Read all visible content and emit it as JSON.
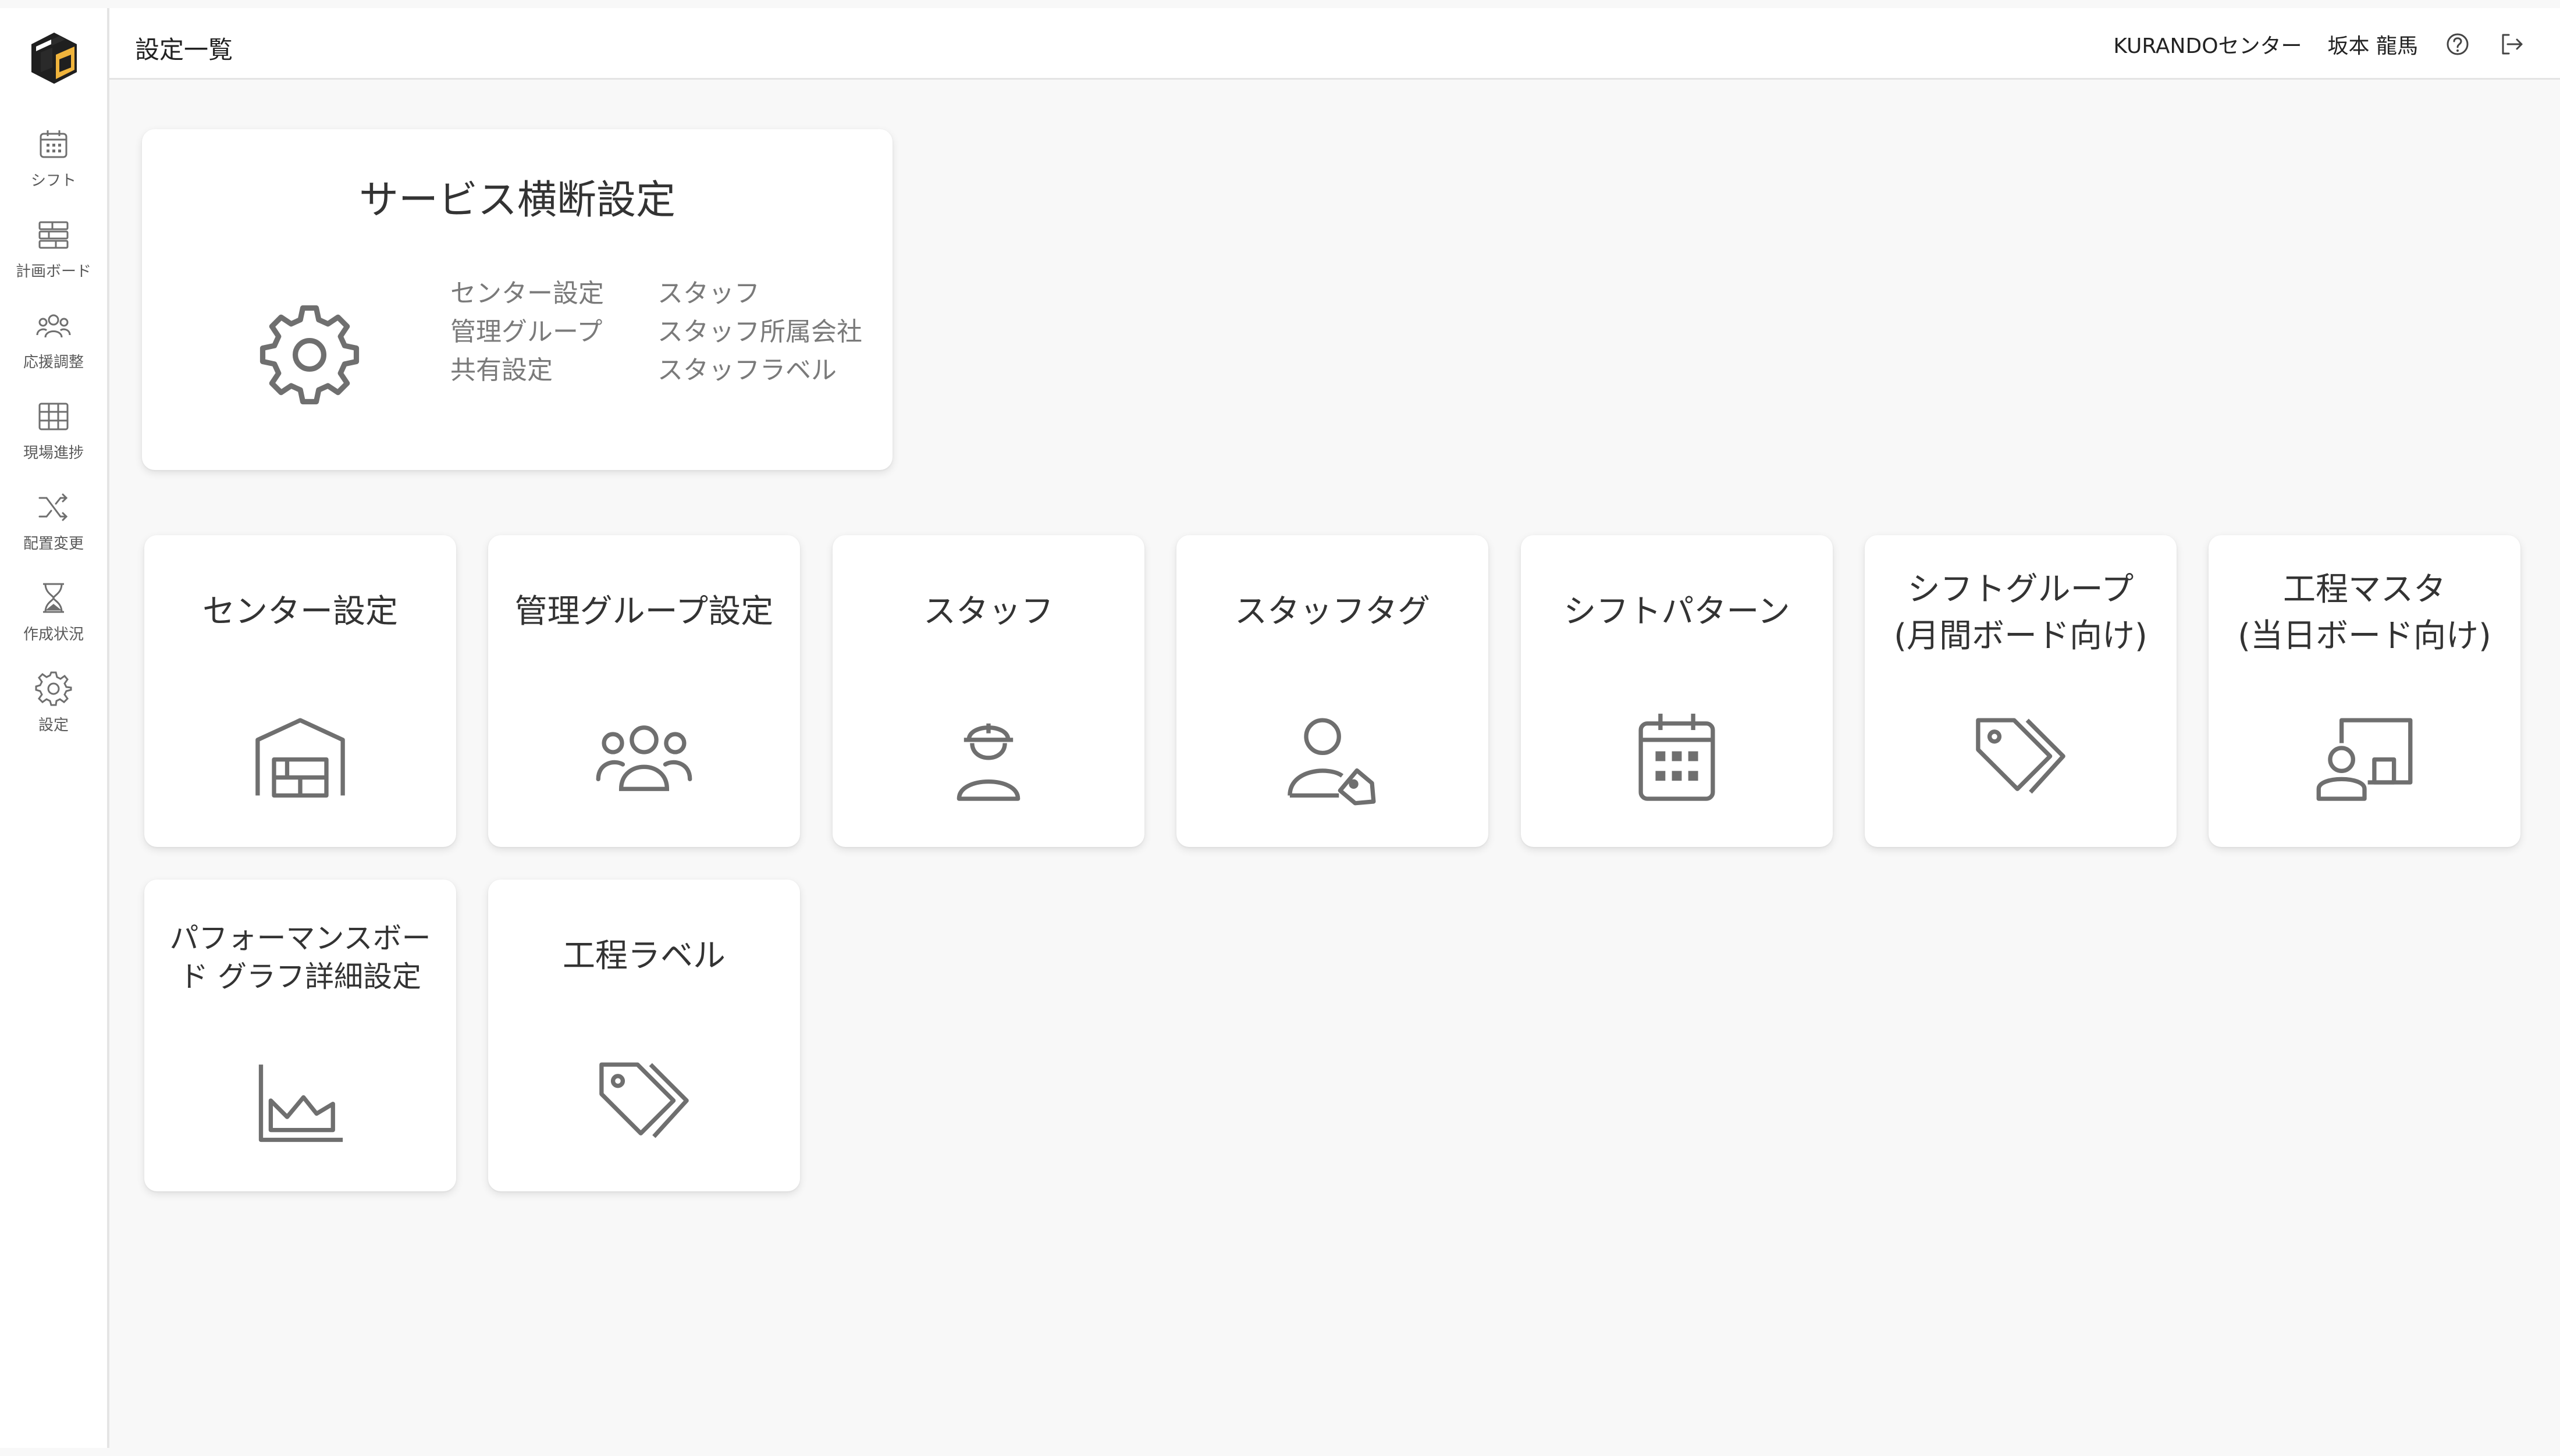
{
  "header": {
    "title": "設定一覧",
    "center_name": "KURANDOセンター",
    "user_name": "坂本 龍馬"
  },
  "sidebar": {
    "items": [
      {
        "label": "シフト",
        "icon": "calendar-icon"
      },
      {
        "label": "計画ボード",
        "icon": "board-icon"
      },
      {
        "label": "応援調整",
        "icon": "people-icon"
      },
      {
        "label": "現場進捗",
        "icon": "table-icon"
      },
      {
        "label": "配置変更",
        "icon": "shuffle-icon"
      },
      {
        "label": "作成状況",
        "icon": "hourglass-icon"
      },
      {
        "label": "設定",
        "icon": "gear-icon"
      }
    ]
  },
  "service_card": {
    "title": "サービス横断設定",
    "links_left": [
      "センター設定",
      "管理グループ",
      "共有設定"
    ],
    "links_right": [
      "スタッフ",
      "スタッフ所属会社",
      "スタッフラベル"
    ]
  },
  "tiles": [
    {
      "line1": "センター設定",
      "line2": "",
      "icon": "warehouse-icon"
    },
    {
      "line1": "管理グループ設定",
      "line2": "",
      "icon": "group-icon"
    },
    {
      "line1": "スタッフ",
      "line2": "",
      "icon": "worker-icon"
    },
    {
      "line1": "スタッフタグ",
      "line2": "",
      "icon": "user-tag-icon"
    },
    {
      "line1": "シフトパターン",
      "line2": "",
      "icon": "calendar-grid-icon"
    },
    {
      "line1": "シフトグループ",
      "line2": "(月間ボード向け)",
      "icon": "tags-icon"
    },
    {
      "line1": "工程マスタ",
      "line2": "(当日ボード向け)",
      "icon": "presenter-icon"
    },
    {
      "line1": "パフォーマンスボー",
      "line2": "ド グラフ詳細設定",
      "icon": "area-chart-icon"
    },
    {
      "line1": "工程ラベル",
      "line2": "",
      "icon": "tags-icon"
    }
  ],
  "colors": {
    "background": "#f8f8f8",
    "card": "#ffffff",
    "icon": "#6f6f6f",
    "logo_gold": "#f0b43c",
    "logo_dark": "#1f1f1f"
  }
}
